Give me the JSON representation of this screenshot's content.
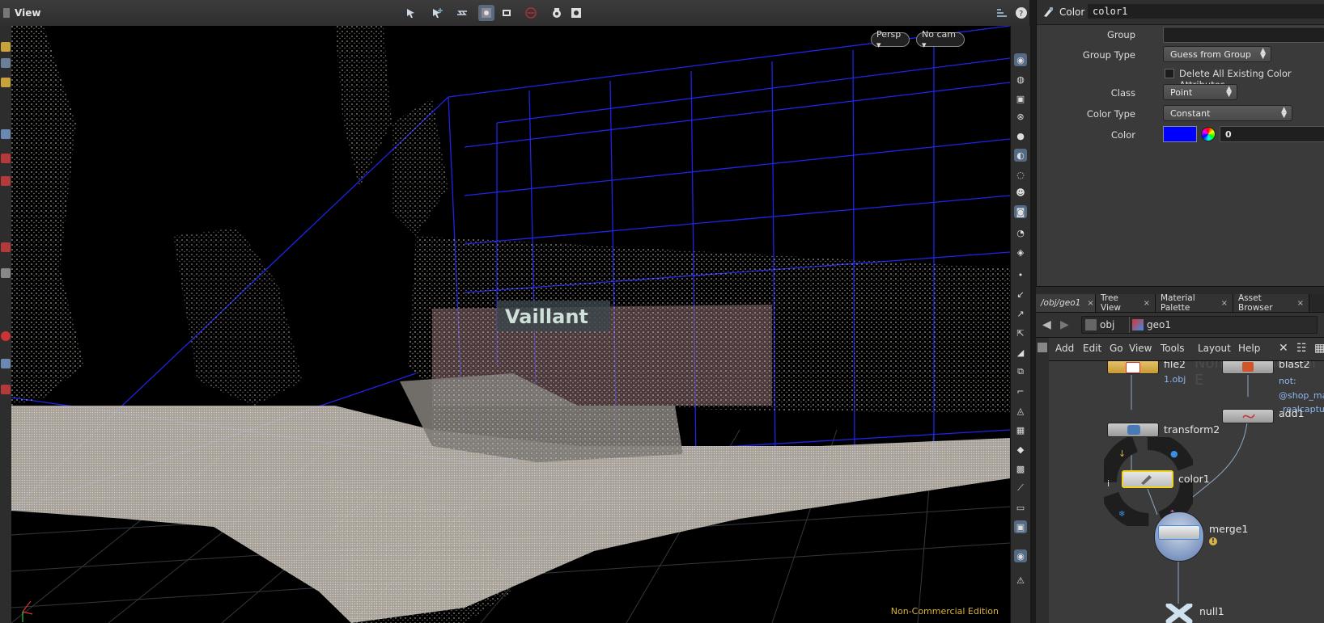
{
  "viewport": {
    "title": "View",
    "camera_menu": "Persp ▾",
    "cam_menu": "No cam ▾",
    "watermark": "Non-Commercial Edition",
    "scene_sign_text": "Vaillant"
  },
  "params": {
    "node_type": "Color",
    "node_name": "color1",
    "group_label": "Group",
    "group_value": "",
    "group_type_label": "Group Type",
    "group_type_value": "Guess from Group",
    "delete_label": "Delete All Existing Color Attributes",
    "class_label": "Class",
    "class_value": "Point",
    "color_type_label": "Color Type",
    "color_type_value": "Constant",
    "color_label": "Color",
    "color_swatch": "#0000ff",
    "color_value": "0"
  },
  "tabs": [
    {
      "label": "/obj/geo1"
    },
    {
      "label": "Tree View"
    },
    {
      "label": "Material Palette"
    },
    {
      "label": "Asset Browser"
    }
  ],
  "path": {
    "seg1": "obj",
    "seg2": "geo1"
  },
  "menu": [
    "Add",
    "Edit",
    "Go",
    "View",
    "Tools",
    "Layout",
    "Help"
  ],
  "network": {
    "watermark": "Non-Commercial E",
    "nodes": {
      "file2": "file2",
      "file2_sub": "1.obj",
      "blast2": "blast2",
      "blast2_sub1": "not:",
      "blast2_sub2": "@shop_ma",
      "blast2_sub3": "realcaptur",
      "add1": "add1",
      "transform2": "transform2",
      "color1": "color1",
      "merge1": "merge1",
      "null1": "null1"
    },
    "info_glyph": "i",
    "warning_glyph": "!"
  },
  "colors": {
    "accent_blue": "#0000ff",
    "node_yellow": "#d8b24a",
    "selected": "#f2d21a"
  }
}
